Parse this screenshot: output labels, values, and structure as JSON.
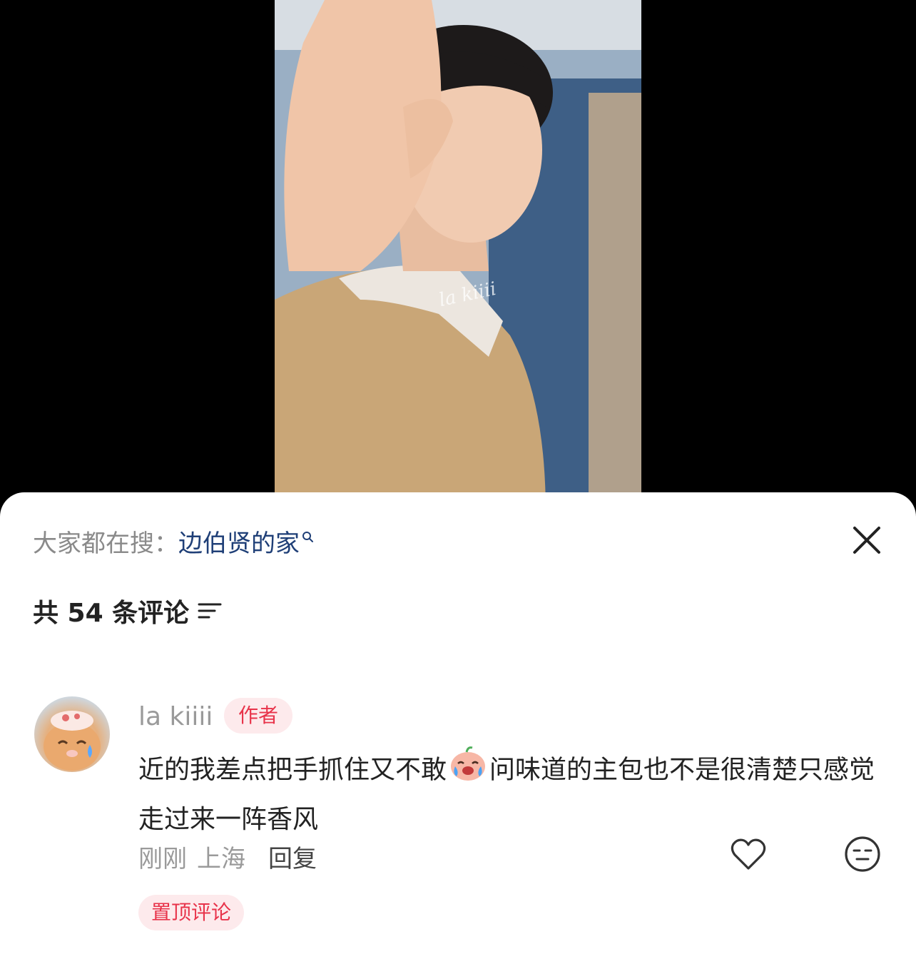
{
  "video": {
    "watermark": "la kiiii"
  },
  "sheet": {
    "search_prefix": "大家都在搜：",
    "search_term": "边伯贤的家",
    "comment_count_label": "共 54 条评论"
  },
  "comment": {
    "username": "la kiiii",
    "author_tag": "作者",
    "text_part1": "近的我差点把手抓住又不敢",
    "text_part2": "问味道的主包也不是很清楚只感觉走过来一阵香风",
    "time": "刚刚",
    "location": "上海",
    "reply_label": "回复",
    "pinned_tag": "置顶评论"
  },
  "colors": {
    "accent": "#e8334a",
    "search_term": "#1f3f77",
    "muted": "#9a9a9a"
  },
  "icons": [
    "search-icon",
    "close-icon",
    "sort-icon",
    "crying-emoji-icon",
    "heart-icon",
    "neutral-face-icon"
  ]
}
